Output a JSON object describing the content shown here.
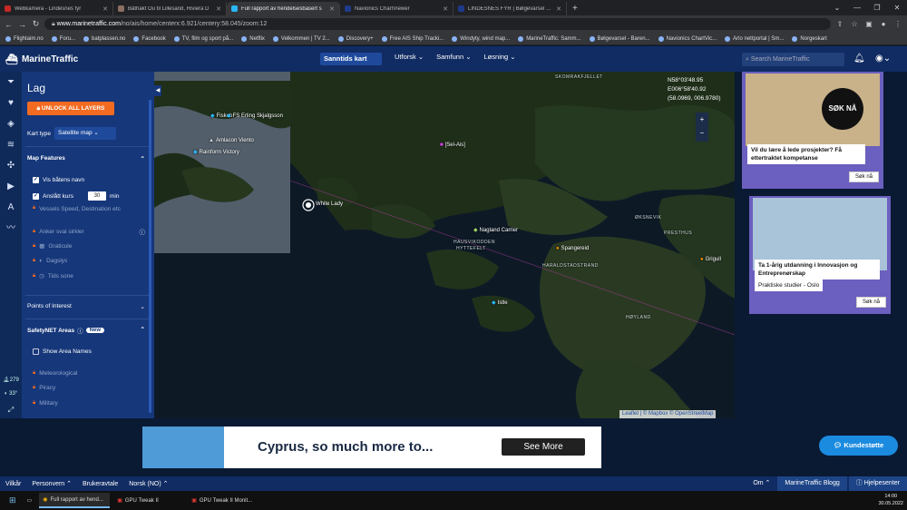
{
  "browser": {
    "tabs": [
      {
        "label": "Webkamera - Lindesnes fyr",
        "color": "#c62828"
      },
      {
        "label": "Båthakt Ou til Lillesand, Riviera D",
        "color": "#8d6e63"
      },
      {
        "label": "Full rapport av hendelsesbasert s",
        "color": "#29b6f6",
        "active": true
      },
      {
        "label": "Navionics ChartViewer",
        "color": "#1e3a8a"
      },
      {
        "label": "LINDESNES FYR | Bølgevarsel - B",
        "color": "#1e3a8a"
      }
    ],
    "new_tab": "+",
    "window_controls": [
      "⌄",
      "—",
      "❐",
      "✕"
    ],
    "url_host": "www.marinetraffic.com",
    "url_path": "/no/ais/home/centerx:6.921/centery:58.045/zoom:12",
    "bookmarks": [
      "Flightaim.no",
      "Foru...",
      "batplassen.no",
      "Facebook",
      "TV, film og sport på...",
      "Netflix",
      "Velkommen | TV 2...",
      "Discovery+",
      "Free AIS Ship Tracki...",
      "Windyty, wind map...",
      "MarineTraffic: Samm...",
      "Bølgevarsel - Baren...",
      "Navionics ChartVic...",
      "Arlo nettportal | Sm...",
      "Norgeskart"
    ]
  },
  "header": {
    "brand": "MarineTraffic",
    "nav": [
      {
        "label": "Sanntids kart",
        "selected": true
      },
      {
        "label": "Utforsk ⌄"
      },
      {
        "label": "Samfunn ⌄"
      },
      {
        "label": "Løsning ⌄"
      }
    ],
    "search_placeholder": "Search MarineTraffic"
  },
  "rail": {
    "count": "279",
    "temp": "33°"
  },
  "layers": {
    "title": "Lag",
    "unlock": "UNLOCK ALL LAYERS",
    "kart_type_label": "Kart type",
    "kart_type_value": "Satellite map",
    "map_features": "Map Features",
    "vis_navn": "Vis båtens navn",
    "anslatt": "Anslått kurs",
    "anslatt_value": "30",
    "anslatt_unit": "min",
    "vessels_speed": "Vessels Speed, Destination etc",
    "anker": "Anker svai sirkler",
    "graticule": "Graticule",
    "dagslys": "Dagslys",
    "tids_sone": "Tids sone",
    "poi": "Points of Interest",
    "safetynet": "SafetyNET Areas",
    "new_badge": "New",
    "show_area": "Show Area Names",
    "meteorological": "Meteorological",
    "piracy": "Piracy",
    "military": "Military"
  },
  "map": {
    "coords": [
      "N58°03'48.95",
      "E006°58'40.92",
      "(58.0969, 006.9780)"
    ],
    "ships": [
      {
        "name": "FS Erling Skjalgsson",
        "color": "#29b6f6"
      },
      {
        "name": "Amlacon Viento",
        "color": "#cfd8dc"
      },
      {
        "name": "Rainform Victory",
        "color": "#29b6f6"
      },
      {
        "name": "Fiskeb",
        "color": "#fdd835"
      },
      {
        "name": "[Sel-Ais]",
        "color": "#e040fb"
      },
      {
        "name": "White Lady",
        "color": "#eeeeee"
      },
      {
        "name": "Nagland Carrier",
        "color": "#9ccc65"
      },
      {
        "name": "Spangereid",
        "color": "#ff9800"
      },
      {
        "name": "Grigull",
        "color": "#ff9800"
      },
      {
        "name": "Istle",
        "color": "#29b6f6"
      }
    ],
    "places": [
      "SKOMRAKFJELLET",
      "HAUSVIKODDEN",
      "HYTTEFELT",
      "HARALDSTADSTRAND",
      "ØKSNEVIK",
      "PRESTHUS",
      "HØYLAND",
      "Spangereid"
    ],
    "attribution": "Leaflet | © Mapbox © OpenStreetMap"
  },
  "ads": {
    "ad1_text": "Vil du lære å lede prosjekter? Få ettertraktet kompetanse",
    "ad1_badge": "SØK NÅ",
    "ad1_btn": "Søk nå",
    "ad2_text": "Ta 1-årig utdanning i Innovasjon og Entreprenørskap",
    "ad2_sub": "Praktiske studier - Oslo",
    "ad2_btn": "Søk nå",
    "banner_text": "Cyprus, so much more to...",
    "banner_btn": "See More"
  },
  "kundestotte": "Kundestøtte",
  "footer": {
    "left": [
      "Vilkår",
      "Personvern ⌃",
      "Brukeravtale",
      "Norsk (NO) ⌃"
    ],
    "om": "Om ⌃",
    "blogg": "MarineTraffic Blogg",
    "hjelp": "Hjelpesenter"
  },
  "taskbar": {
    "apps": [
      "Full rapport av hend...",
      "GPU Tweak II",
      "GPU Tweak II Monit..."
    ],
    "time": "14:00",
    "date": "30.05.2022"
  }
}
